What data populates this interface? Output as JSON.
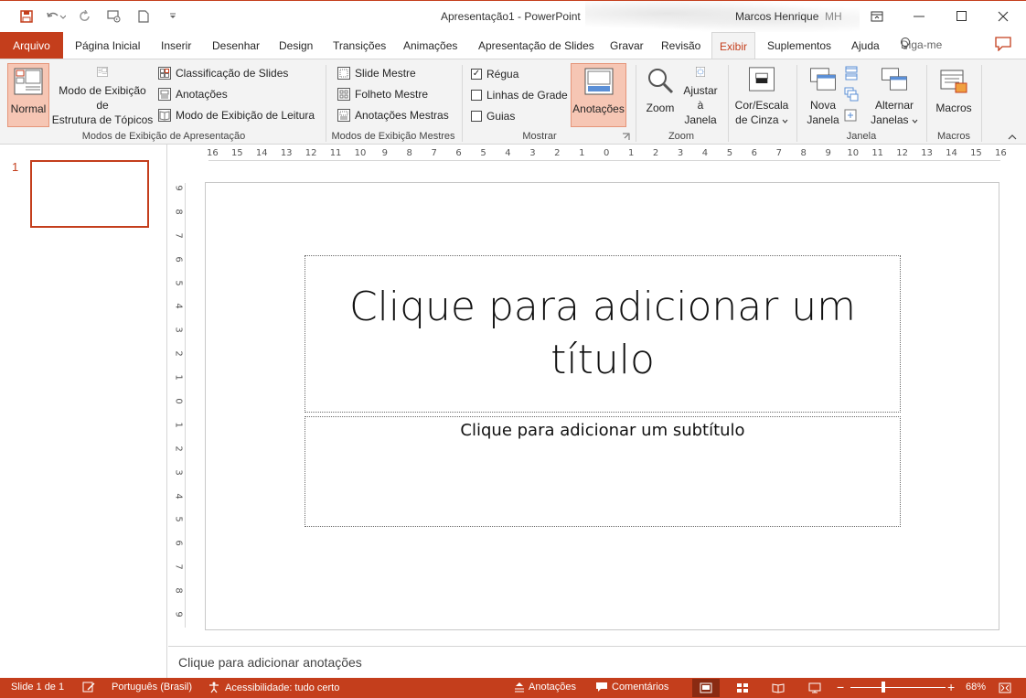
{
  "titlebar": {
    "doc_title": "Apresentação1  -  PowerPoint",
    "user_name": "Marcos Henrique",
    "user_initials": "MH"
  },
  "tabs": {
    "file": "Arquivo",
    "items": [
      "Página Inicial",
      "Inserir",
      "Desenhar",
      "Design",
      "Transições",
      "Animações",
      "Apresentação de Slides",
      "Gravar",
      "Revisão",
      "Exibir",
      "Suplementos",
      "Ajuda"
    ],
    "active": "Exibir",
    "tell_me": "Diga-me"
  },
  "ribbon": {
    "presentation_views": {
      "label": "Modos de Exibição de Apresentação",
      "normal": "Normal",
      "outline_line1": "Modo de Exibição de",
      "outline_line2": "Estrutura de Tópicos",
      "slide_sorter": "Classificação de Slides",
      "notes_page": "Anotações",
      "reading_view": "Modo de Exibição de Leitura"
    },
    "master_views": {
      "label": "Modos de Exibição Mestres",
      "slide_master": "Slide Mestre",
      "handout_master": "Folheto Mestre",
      "notes_master": "Anotações Mestras"
    },
    "show": {
      "label": "Mostrar",
      "ruler": "Régua",
      "ruler_checked": true,
      "gridlines": "Linhas de Grade",
      "guides": "Guias",
      "notes": "Anotações"
    },
    "zoom": {
      "label": "Zoom",
      "zoom": "Zoom",
      "fit_line1": "Ajustar",
      "fit_line2": "à Janela"
    },
    "color": {
      "line1": "Cor/Escala",
      "line2": "de Cinza"
    },
    "window": {
      "label": "Janela",
      "new_line1": "Nova",
      "new_line2": "Janela",
      "switch_line1": "Alternar",
      "switch_line2": "Janelas"
    },
    "macros": {
      "label": "Macros",
      "macros": "Macros"
    }
  },
  "thumbnails": {
    "slide_number": "1"
  },
  "ruler": {
    "horizontal": [
      "16",
      "15",
      "14",
      "13",
      "12",
      "11",
      "10",
      "9",
      "8",
      "7",
      "6",
      "5",
      "4",
      "3",
      "2",
      "1",
      "0",
      "1",
      "2",
      "3",
      "4",
      "5",
      "6",
      "7",
      "8",
      "9",
      "10",
      "11",
      "12",
      "13",
      "14",
      "15",
      "16"
    ],
    "vertical": [
      "9",
      "8",
      "7",
      "6",
      "5",
      "4",
      "3",
      "2",
      "1",
      "0",
      "1",
      "2",
      "3",
      "4",
      "5",
      "6",
      "7",
      "8",
      "9"
    ]
  },
  "slide": {
    "title_placeholder": "Clique para adicionar um título",
    "subtitle_placeholder": "Clique para adicionar um subtítulo"
  },
  "notes": {
    "placeholder": "Clique para adicionar anotações"
  },
  "statusbar": {
    "slide_count": "Slide 1 de 1",
    "language": "Português (Brasil)",
    "accessibility": "Acessibilidade: tudo certo",
    "notes": "Anotações",
    "comments": "Comentários",
    "zoom_level": "68%",
    "zoom_fraction": 0.33
  },
  "colors": {
    "accent": "#c43e1c",
    "ribbon_bg": "#f3f3f3",
    "selected_btn": "#f6c6b4"
  }
}
